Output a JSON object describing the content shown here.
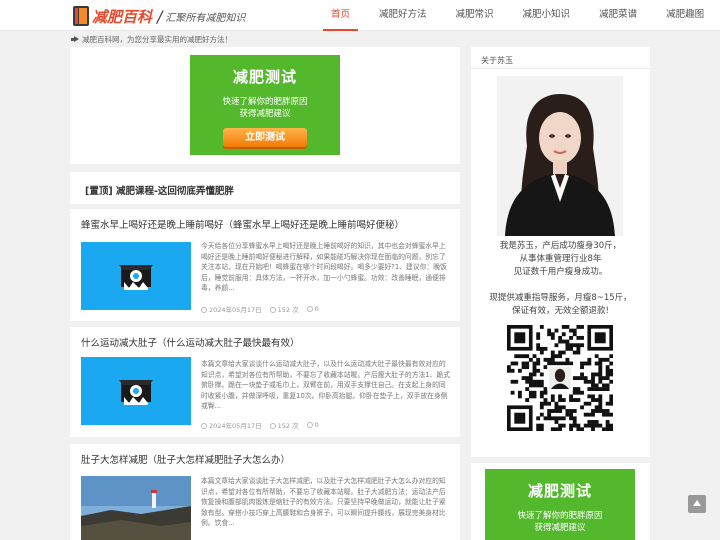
{
  "header": {
    "logo_name": "减肥百科",
    "logo_slash": "/",
    "logo_sub": "汇聚所有减肥知识",
    "nav": [
      "首页",
      "减肥好方法",
      "减肥常识",
      "减肥小知识",
      "减肥菜谱",
      "减肥趣图"
    ]
  },
  "notice": "减肥百科网，为您分享最实用的减肥好方法！",
  "ad": {
    "title": "减肥测试",
    "line1": "快速了解你的肥胖原因",
    "line2": "获得减肥建议",
    "button": "立即测试"
  },
  "sticky": "[置顶] 减肥课程-这回彻底弄懂肥胖",
  "articles": [
    {
      "title": "蜂蜜水早上喝好还是晚上睡前喝好（蜂蜜水早上喝好还是晚上睡前喝好便秘）",
      "desc": "今天给各位分享蜂蜜水早上喝好还是晚上睡前喝好的知识，其中也会对蜂蜜水早上喝好还是晚上睡前喝好便秘进行解释，如果能碰巧解决你现在面临的问题，别忘了关注本站，现在开始吧！喝蜂蜜在哪个时间段喝好。喝多少要好?1、建议你：晚饭后，睡觉前服用：具体方法，一杯开水，加一小勺蜂蜜。功效：改善睡眠，通便排毒，养颜...",
      "date": "2024年05月17日",
      "views": "152 次",
      "comments": "0"
    },
    {
      "title": "什么运动减大肚子（什么运动减大肚子最快最有效）",
      "desc": "本篇文章给大家谈谈什么运动减大肚子，以及什么运动减大肚子最快最有效对应的知识点，希望对各位有所帮助，不要忘了收藏本站喔。产后瘦大肚子的方法1、跪式俯卧撑。跪在一块垫子或毛巾上，双臂在前，用双手支撑住自己。在支起上身的同时收紧小腹，并做深呼吸，重复10次。仰卧高抬腿。仰卧在垫子上，双手放在身侧或臀...",
      "date": "2024年05月17日",
      "views": "152 次",
      "comments": "0"
    },
    {
      "title": "肚子大怎样减肥（肚子大怎样减肥肚子大怎么办）",
      "desc": "本篇文章给大家谈谈肚子大怎样减肥，以及肚子大怎样减肥肚子大怎么办对应的知识点，希望对各位有所帮助，不要忘了收藏本站喔。肚子大减肥方法：运动法产后恢复操和腹部肌肉锻炼是缩肚子的有效方法。只要坚持早晚做运动，就能让肚子紧致有型。穿搭小技巧穿上高腰鞋和合身裤子，可以瞬间提升腰线，展现完美身材比例。饮食..."
    }
  ],
  "sidebar": {
    "about_title": "关于苏玉",
    "bio1": "我是苏玉，产后成功瘦身30斤，",
    "bio2": "从事体重管理行业8年",
    "bio3": "见证数千用户瘦身成功。",
    "bio4": "现提供减重指导服务，月瘦8~15斤，",
    "bio5": "保证有效，无效全额退款!"
  },
  "colors": {
    "accent": "#e8492c",
    "ad_green": "#54b82d",
    "thumb_blue": "#1aa8f0"
  }
}
